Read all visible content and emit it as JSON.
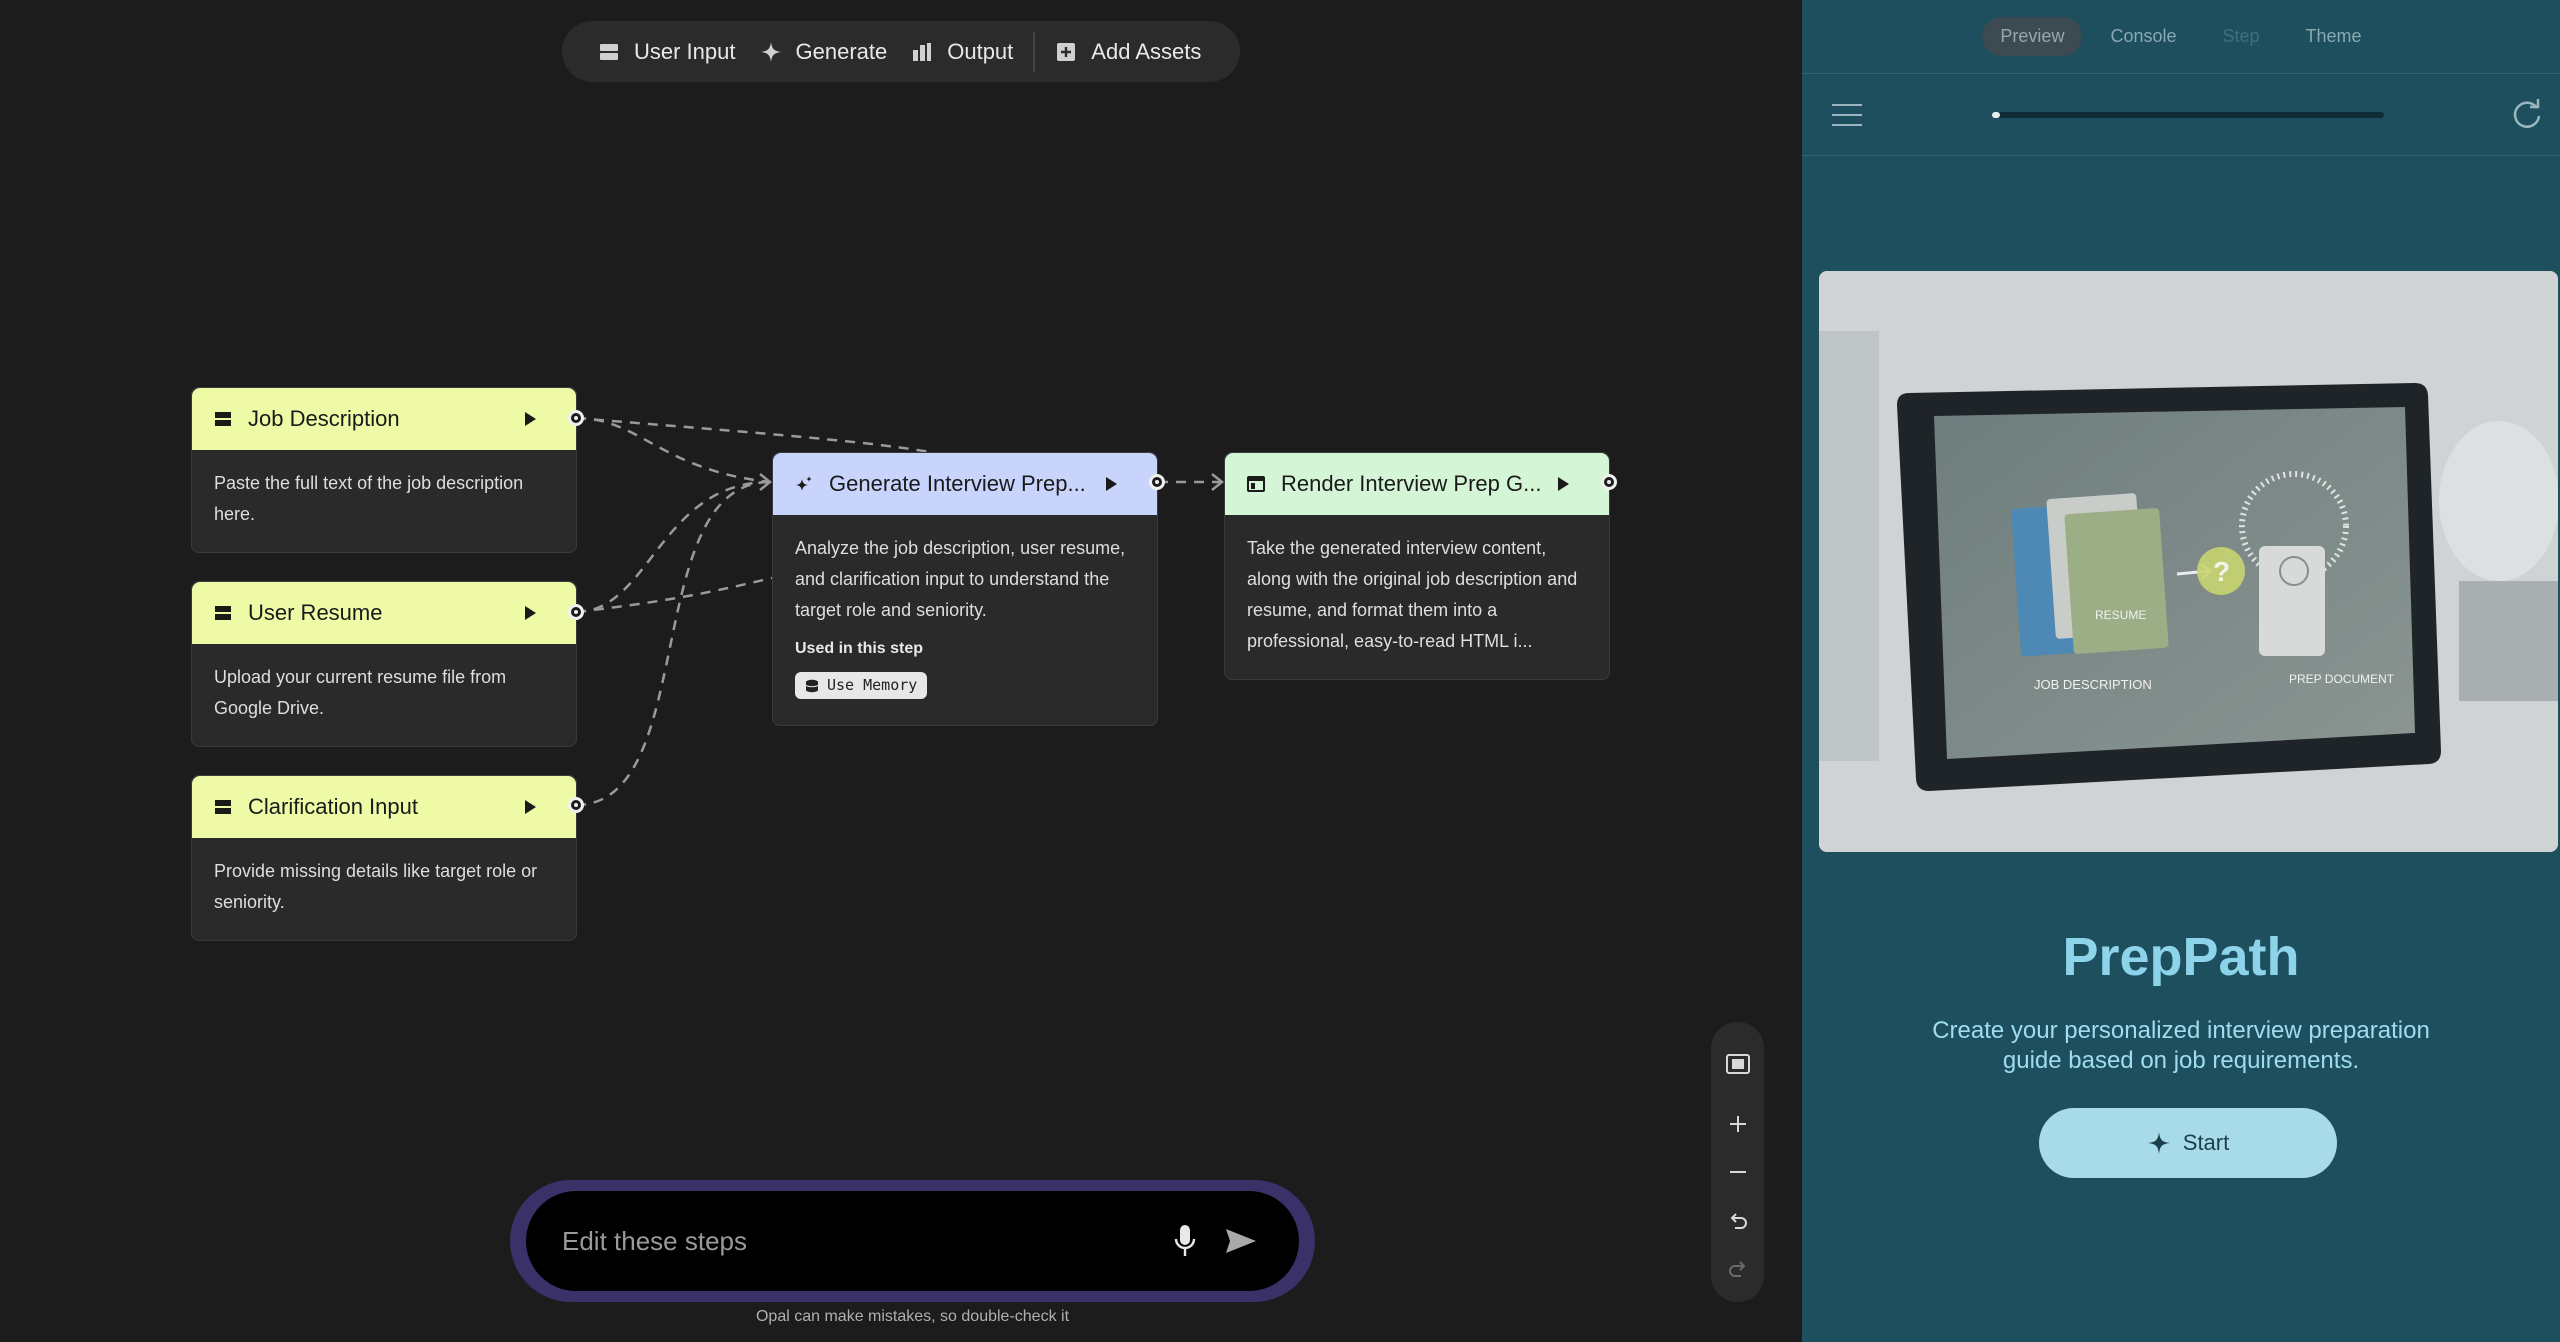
{
  "toolbar": {
    "user_input": "User Input",
    "generate": "Generate",
    "output": "Output",
    "add_assets": "Add Assets"
  },
  "nodes": {
    "job_description": {
      "title": "Job Description",
      "body": "Paste the full text of the job description here."
    },
    "user_resume": {
      "title": "User Resume",
      "body": "Upload your current resume file from Google Drive."
    },
    "clarification": {
      "title": "Clarification Input",
      "body": "Provide missing details like target role or seniority."
    },
    "generate": {
      "title": "Generate Interview Prep...",
      "body": "Analyze the job description, user resume, and clarification input to understand the target role and seniority.",
      "used_label": "Used in this step",
      "chip": "Use Memory"
    },
    "render": {
      "title": "Render Interview Prep G...",
      "body": "Take the generated interview content, along with the original job description and resume, and format them into a professional, easy-to-read HTML i..."
    }
  },
  "prompt": {
    "placeholder": "Edit these steps"
  },
  "disclaimer": "Opal can make mistakes, so double-check it",
  "panel": {
    "tabs": [
      "Preview",
      "Console",
      "Step",
      "Theme"
    ],
    "active_tab": "Preview",
    "progress": 0.02,
    "hero": {
      "label_job": "JOB DESCRIPTION",
      "label_resume": "RESUME",
      "label_prep": "PREP DOCUMENT"
    },
    "app_title": "PrepPath",
    "app_description": "Create your personalized interview preparation guide based on job requirements.",
    "start_label": "Start"
  },
  "colors": {
    "canvas_bg": "#1c1c1c",
    "input_node": "#eefaa6",
    "generate_node": "#c8d4fc",
    "output_node": "#d4f5d6",
    "panel_bg": "#1e4f5e",
    "accent_title": "#8dd4ea"
  }
}
